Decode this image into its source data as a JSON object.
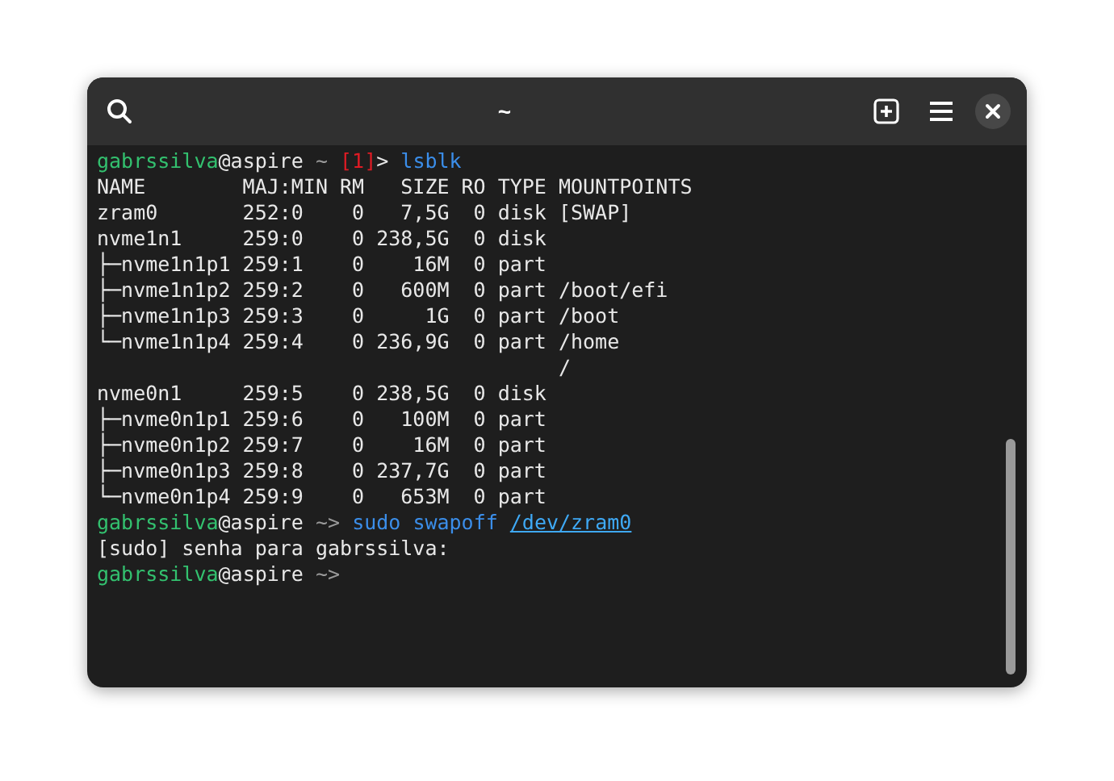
{
  "window": {
    "title": "~"
  },
  "terminal": {
    "lines": [
      [
        {
          "kind": "user",
          "text": "gabrssilva"
        },
        {
          "kind": "host",
          "text": "@aspire"
        },
        {
          "kind": "cwd",
          "text": " ~ "
        },
        {
          "kind": "status",
          "text": "[1]"
        },
        {
          "kind": "plain",
          "text": "> "
        },
        {
          "kind": "command",
          "text": "lsblk"
        }
      ],
      [
        {
          "kind": "plain",
          "text": "NAME        MAJ:MIN RM   SIZE RO TYPE MOUNTPOINTS"
        }
      ],
      [
        {
          "kind": "plain",
          "text": "zram0       252:0    0   7,5G  0 disk [SWAP]"
        }
      ],
      [
        {
          "kind": "plain",
          "text": "nvme1n1     259:0    0 238,5G  0 disk"
        }
      ],
      [
        {
          "kind": "plain",
          "text": "├─nvme1n1p1 259:1    0    16M  0 part"
        }
      ],
      [
        {
          "kind": "plain",
          "text": "├─nvme1n1p2 259:2    0   600M  0 part /boot/efi"
        }
      ],
      [
        {
          "kind": "plain",
          "text": "├─nvme1n1p3 259:3    0     1G  0 part /boot"
        }
      ],
      [
        {
          "kind": "plain",
          "text": "└─nvme1n1p4 259:4    0 236,9G  0 part /home"
        }
      ],
      [
        {
          "kind": "plain",
          "text": "                                      /"
        }
      ],
      [
        {
          "kind": "plain",
          "text": "nvme0n1     259:5    0 238,5G  0 disk"
        }
      ],
      [
        {
          "kind": "plain",
          "text": "├─nvme0n1p1 259:6    0   100M  0 part"
        }
      ],
      [
        {
          "kind": "plain",
          "text": "├─nvme0n1p2 259:7    0    16M  0 part"
        }
      ],
      [
        {
          "kind": "plain",
          "text": "├─nvme0n1p3 259:8    0 237,7G  0 part"
        }
      ],
      [
        {
          "kind": "plain",
          "text": "└─nvme0n1p4 259:9    0   653M  0 part"
        }
      ],
      [
        {
          "kind": "user",
          "text": "gabrssilva"
        },
        {
          "kind": "host",
          "text": "@aspire"
        },
        {
          "kind": "cwd",
          "text": " ~> "
        },
        {
          "kind": "command",
          "text": "sudo swapoff "
        },
        {
          "kind": "path",
          "text": "/dev/zram0"
        }
      ],
      [
        {
          "kind": "plain",
          "text": "[sudo] senha para gabrssilva:"
        }
      ],
      [
        {
          "kind": "user",
          "text": "gabrssilva"
        },
        {
          "kind": "host",
          "text": "@aspire"
        },
        {
          "kind": "cwd",
          "text": " ~>"
        }
      ]
    ]
  }
}
